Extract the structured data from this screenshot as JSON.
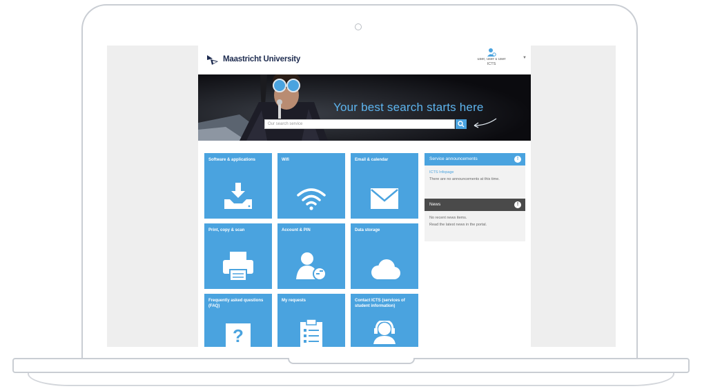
{
  "header": {
    "logo_text": "Maastricht University",
    "user_name": "user, user u user",
    "user_sub": "ICTS"
  },
  "hero": {
    "tagline": "Your best search starts here",
    "search_placeholder": "Our search service"
  },
  "tiles": [
    {
      "label": "Software & applications",
      "icon": "download-icon"
    },
    {
      "label": "Wifi",
      "icon": "wifi-icon"
    },
    {
      "label": "Email & calendar",
      "icon": "mail-icon"
    },
    {
      "label": "Print, copy & scan",
      "icon": "printer-icon"
    },
    {
      "label": "Account & PIN",
      "icon": "account-icon"
    },
    {
      "label": "Data storage",
      "icon": "cloud-icon"
    },
    {
      "label": "Frequently asked questions (FAQ)",
      "icon": "question-icon"
    },
    {
      "label": "My requests",
      "icon": "clipboard-icon"
    },
    {
      "label": "Contact ICTS (services of student information)",
      "icon": "support-icon"
    }
  ],
  "side": {
    "panel1": {
      "title": "Service announcements",
      "badge": "!",
      "link": "ICTS Infopage",
      "text": "There are no announcements at this time."
    },
    "panel2": {
      "title": "News",
      "badge": "!",
      "link": "No recent news items.",
      "text": "Read the latest news in the portal."
    }
  },
  "colors": {
    "tile": "#4aa3df",
    "accent": "#5db4ee",
    "dark_panel": "#4a4a4a"
  }
}
